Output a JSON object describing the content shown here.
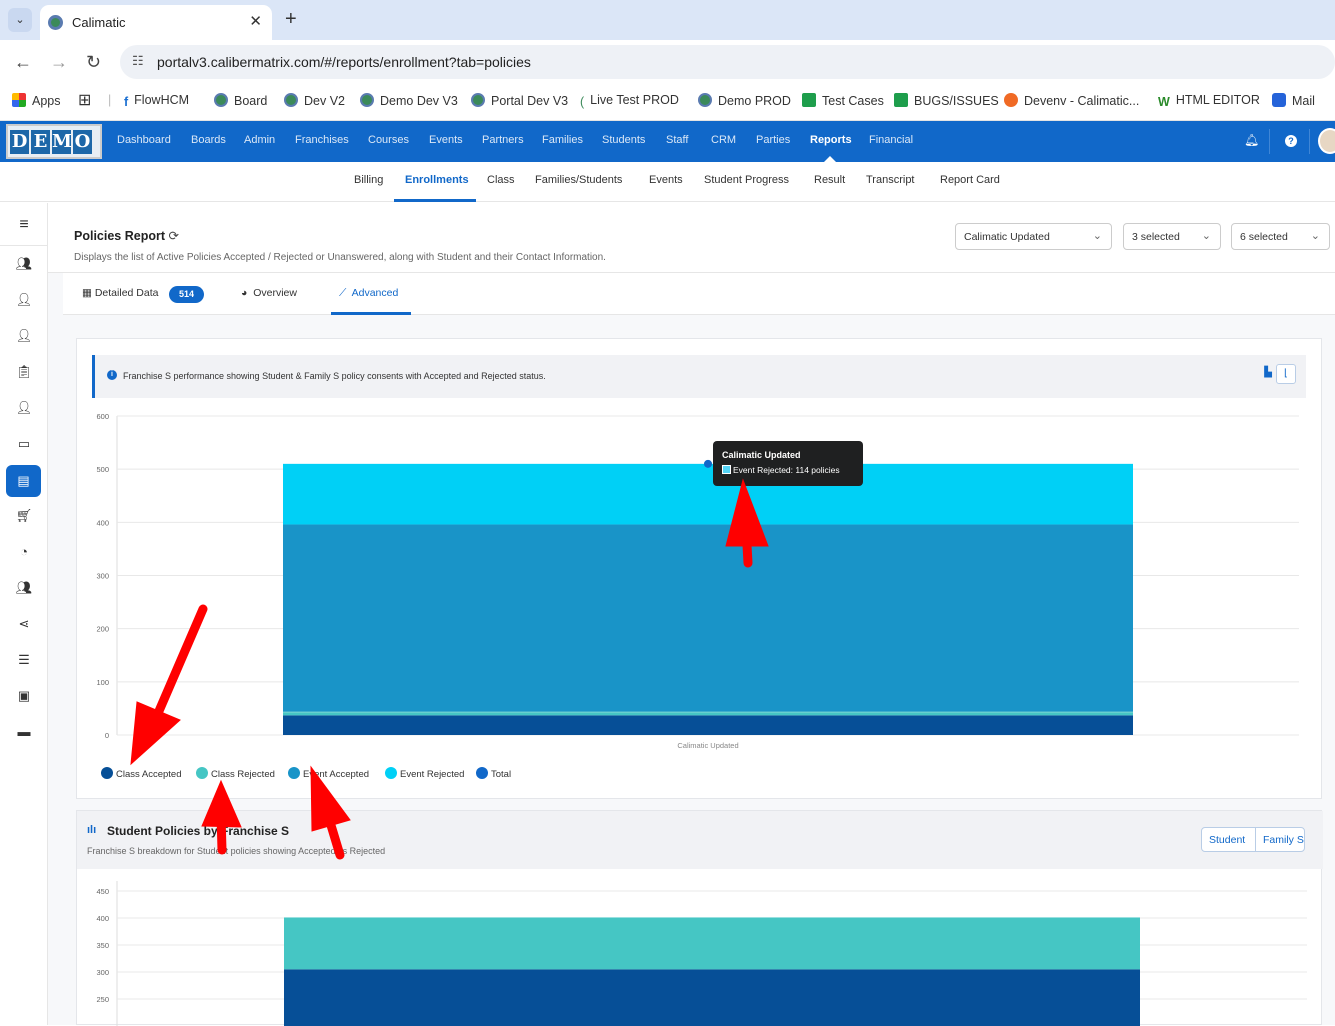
{
  "browser": {
    "tab_title": "Calimatic",
    "url": "portalv3.calibermatrix.com/#/reports/enrollment?tab=policies",
    "bookmarks": [
      "Apps",
      "FlowHCM",
      "Board",
      "Dev V2",
      "Demo Dev V3",
      "Portal Dev V3",
      "Live Test PROD",
      "Demo PROD",
      "Test Cases",
      "BUGS/ISSUES",
      "Devenv - Calimatic...",
      "HTML EDITOR",
      "Mail"
    ]
  },
  "app": {
    "logo_letters": [
      "D",
      "E",
      "M",
      "O"
    ],
    "menu": [
      "Dashboard",
      "Boards",
      "Admin",
      "Franchises",
      "Courses",
      "Events",
      "Partners",
      "Families",
      "Students",
      "Staff",
      "CRM",
      "Parties",
      "Reports",
      "Financial"
    ],
    "active_menu": "Reports",
    "submenu": [
      "Billing",
      "Enrollments",
      "Class",
      "Families/Students",
      "Events",
      "Student Progress",
      "Result",
      "Transcript",
      "Report Card"
    ],
    "active_submenu": "Enrollments"
  },
  "page": {
    "title": "Policies Report",
    "description": "Displays the list of Active Policies Accepted / Rejected or Unanswered, along with Student and their Contact Information.",
    "filters": [
      "Calimatic Updated",
      "3 selected",
      "6 selected"
    ],
    "tabs": {
      "detailed": "Detailed Data",
      "count": "514",
      "overview": "Overview",
      "advanced": "Advanced"
    }
  },
  "card1": {
    "info": "Franchise S performance showing Student & Family S policy consents with Accepted and Rejected status.",
    "tooltip": {
      "title": "Calimatic Updated",
      "line": "Event Rejected: 114 policies"
    },
    "legend": [
      "Class Accepted",
      "Class Rejected",
      "Event Accepted",
      "Event Rejected",
      "Total"
    ]
  },
  "card2": {
    "title": "Student Policies by Franchise S",
    "description": "Franchise S breakdown for Student policies showing Accepted vs Rejected",
    "toggle": [
      "Student",
      "Family S"
    ]
  },
  "colors": {
    "accent": "#1168c9",
    "class_accepted": "#064f97",
    "class_rejected": "#45c6c4",
    "event_accepted": "#1994c8",
    "event_rejected": "#00d0f6",
    "total": "#1168c9"
  },
  "chart_data": [
    {
      "type": "area",
      "categories": [
        "Calimatic Updated"
      ],
      "ylim": [
        0,
        600
      ],
      "yticks": [
        0,
        100,
        200,
        300,
        400,
        500,
        600
      ],
      "series": [
        {
          "name": "Class Accepted",
          "values": [
            37
          ]
        },
        {
          "name": "Class Rejected",
          "values": [
            7
          ]
        },
        {
          "name": "Event Accepted",
          "values": [
            352
          ]
        },
        {
          "name": "Event Rejected",
          "values": [
            114
          ]
        }
      ]
    },
    {
      "type": "bar",
      "categories": [
        ""
      ],
      "ylim": [
        250,
        450
      ],
      "yticks": [
        250,
        300,
        350,
        400,
        450
      ],
      "series": [
        {
          "name": "Accepted",
          "values": [
            305
          ]
        },
        {
          "name": "Rejected",
          "values": [
            96
          ]
        }
      ]
    }
  ]
}
